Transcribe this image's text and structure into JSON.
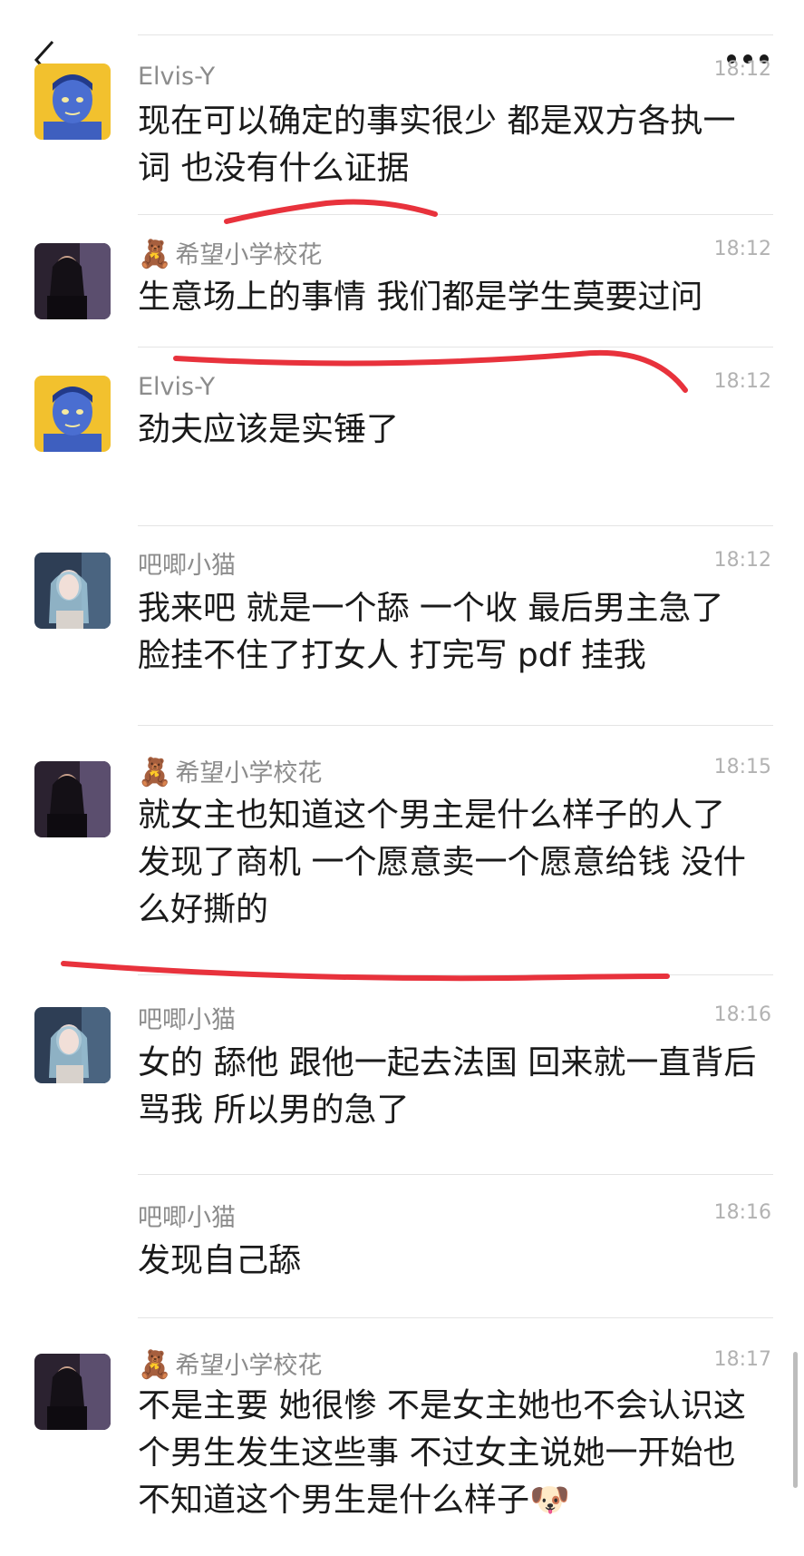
{
  "header": {
    "back_icon": "chevron-left-icon",
    "more_icon": "more-dots-icon"
  },
  "colors": {
    "annotation_red": "#e8323c",
    "name_gray": "#8c8c8c",
    "time_gray": "#b2b2b2"
  },
  "messages": [
    {
      "sender": "Elvis-Y",
      "time": "18:12",
      "text": "现在可以确定的事实很少 都是双方各执一词 也没有什么证据",
      "badge": ""
    },
    {
      "sender": "希望小学校花",
      "time": "18:12",
      "text": "生意场上的事情 我们都是学生莫要过问",
      "badge": "🧸"
    },
    {
      "sender": "Elvis-Y",
      "time": "18:12",
      "text": "劲夫应该是实锤了",
      "badge": ""
    },
    {
      "sender": "吧唧小猫",
      "time": "18:12",
      "text": "我来吧 就是一个舔 一个收 最后男主急了 脸挂不住了打女人 打完写 pdf 挂我",
      "badge": ""
    },
    {
      "sender": "希望小学校花",
      "time": "18:15",
      "text": "就女主也知道这个男主是什么样子的人了 发现了商机 一个愿意卖一个愿意给钱 没什么好撕的",
      "badge": "🧸"
    },
    {
      "sender": "吧唧小猫",
      "time": "18:16",
      "text": "女的 舔他 跟他一起去法国 回来就一直背后骂我 所以男的急了",
      "badge": ""
    },
    {
      "sender": "吧唧小猫",
      "time": "18:16",
      "text": "发现自己舔",
      "badge": ""
    },
    {
      "sender": "希望小学校花",
      "time": "18:17",
      "text": "不是主要 她很惨 不是女主她也不会认识这个男生发生这些事 不过女主说她一开始也不知道这个男生是什么样子🐶",
      "badge": "🧸"
    }
  ]
}
